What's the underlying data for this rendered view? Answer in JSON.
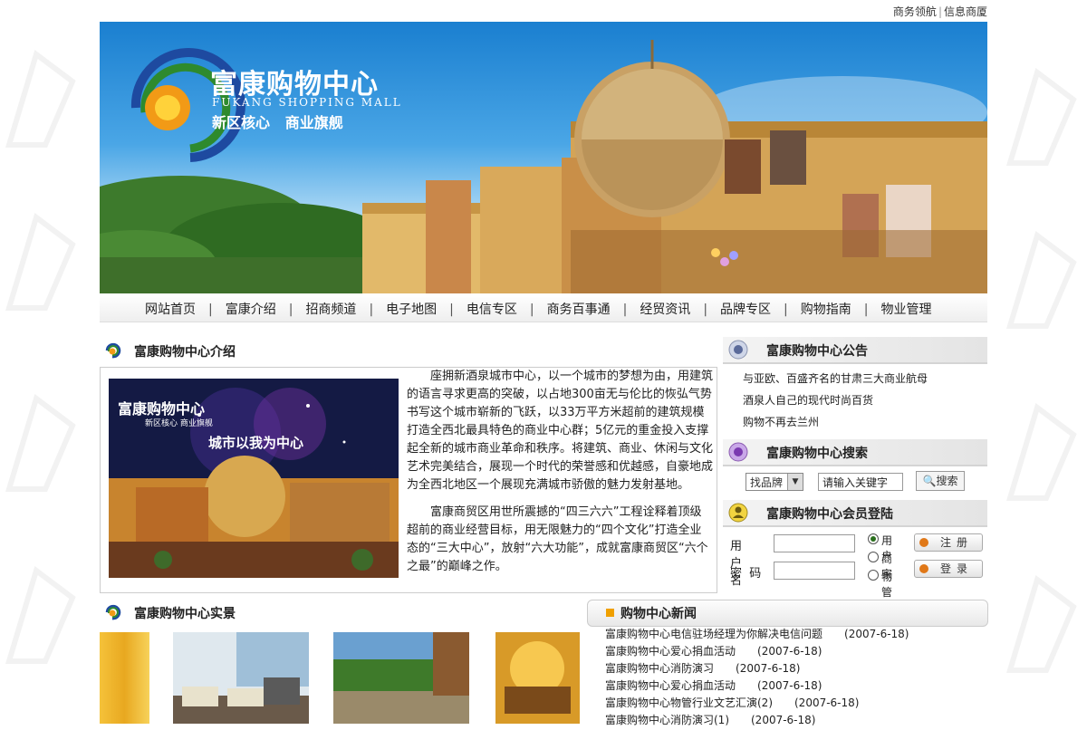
{
  "top_links": {
    "link1": "商务领航",
    "sep": "|",
    "link2": "信息商厦"
  },
  "banner": {
    "logo_cn": "富康购物中心",
    "logo_en": "FUKANG SHOPPING MALL",
    "slogan": "新区核心   商业旗舰"
  },
  "nav": {
    "items": [
      "网站首页",
      "富康介绍",
      "招商频道",
      "电子地图",
      "电信专区",
      "商务百事通",
      "经贸资讯",
      "品牌专区",
      "购物指南",
      "物业管理"
    ],
    "separator": "|"
  },
  "intro": {
    "title": "富康购物中心介绍",
    "image_logo": "富康购物中心",
    "image_logo_sub": "新区核心 商业旗舰",
    "image_caption": "城市以我为中心",
    "paragraph1": "座拥新酒泉城市中心，以一个城市的梦想为由，用建筑的语言寻求更高的突破，以占地300亩无与伦比的恢弘气势书写这个城市崭新的飞跃，以33万平方米超前的建筑规模打造全西北最具特色的商业中心群；5亿元的重金投入支撑起全新的城市商业革命和秩序。将建筑、商业、休闲与文化艺术完美结合，展现一个时代的荣誉感和优越感，自豪地成为全西北地区一个展现充满城市骄傲的魅力发射基地。",
    "paragraph2": "富康商贸区用世所震撼的“四三六六”工程诠释着顶级超前的商业经营目标，用无限魅力的“四个文化”打造全业态的“三大中心”，放射“六大功能”，成就富康商贸区“六个之最”的巅峰之作。"
  },
  "notice": {
    "title": "富康购物中心公告",
    "items": [
      "与亚欧、百盛齐名的甘肃三大商业航母",
      "酒泉人自己的现代时尚百货",
      "购物不再去兰州"
    ]
  },
  "search": {
    "title": "富康购物中心搜索",
    "select_value": "找品牌",
    "keyword_value": "请输入关键字",
    "button": "搜索"
  },
  "member": {
    "title": "富康购物中心会员登陆",
    "username_label": "用户名",
    "password_label": "密  码",
    "radios": [
      "用户",
      "商家",
      "物管"
    ],
    "selected_radio": "用户",
    "register": "注册",
    "login": "登录"
  },
  "gallery": {
    "title": "富康购物中心实景"
  },
  "news": {
    "title": "购物中心新闻",
    "items": [
      {
        "title": "富康购物中心电信驻场经理为你解决电信问题",
        "date": "(2007-6-18)"
      },
      {
        "title": "富康购物中心爱心捐血活动",
        "date": "(2007-6-18)"
      },
      {
        "title": "富康购物中心消防演习",
        "date": "(2007-6-18)"
      },
      {
        "title": "富康购物中心爱心捐血活动",
        "date": "(2007-6-18)"
      },
      {
        "title": "富康购物中心物管行业文艺汇演(2)",
        "date": "(2007-6-18)"
      },
      {
        "title": "富康购物中心消防演习(1)",
        "date": "(2007-6-18)"
      }
    ]
  },
  "colors": {
    "accent": "#f0a000",
    "nav_text": "#222222",
    "banner_sky": "#4aa6e6",
    "logo_orange": "#f29a16"
  },
  "icons": {
    "section": "fukang-logo-icon",
    "notice": "notice-icon",
    "search": "magnifier-icon",
    "member": "member-icon"
  }
}
